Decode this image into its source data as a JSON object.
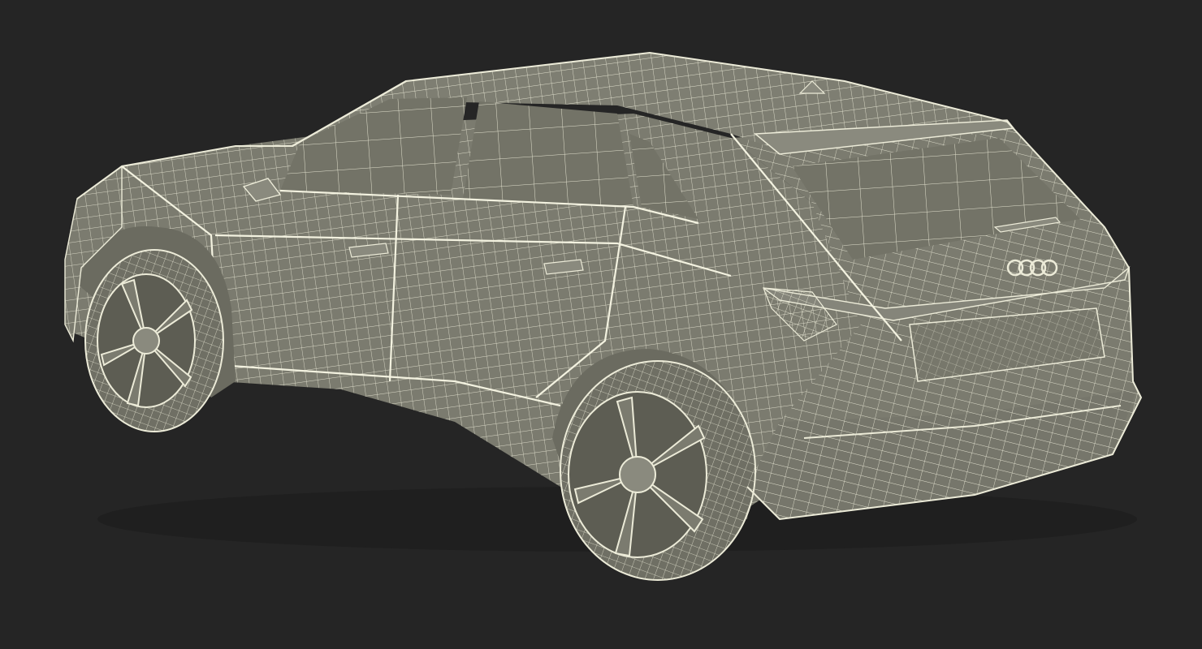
{
  "scene": {
    "subject": "wireframe-suv-rear-three-quarter",
    "colors": {
      "background": "#252525",
      "body_fill": "#7b7b6f",
      "glass_fill": "#737367",
      "wire": "#ecebd8",
      "wire_dim": "#c9c8b4",
      "tire_fill": "#6f6f64",
      "shadow": "#1c1c1c"
    },
    "icons": [
      "audi-rings-logo",
      "car-wireframe"
    ]
  }
}
